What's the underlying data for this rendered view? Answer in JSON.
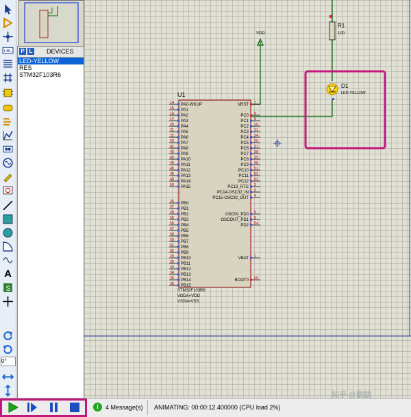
{
  "devices_panel": {
    "p_button": "P",
    "l_button": "L",
    "title": "DEVICES",
    "items": [
      "LED-YELLOW",
      "RES",
      "STM32F103R6"
    ],
    "selected_index": 0
  },
  "toolbar": {
    "rotation_value": "0°"
  },
  "status_bar": {
    "messages": "4 Message(s)",
    "info_icon": "i",
    "animating": "ANIMATING: 00:00:12.400000 (CPU load 2%)",
    "watermark": "知乎 @鼩鼩"
  },
  "schematic": {
    "mcu": {
      "ref": "U1",
      "part": "STM32F103R6",
      "attr_1": "VDDA=VDD",
      "attr_2": "VSSA=VSS",
      "left_pins": [
        {
          "num": "14",
          "name": "PA0-WKUP"
        },
        {
          "num": "15",
          "name": "PA1"
        },
        {
          "num": "16",
          "name": "PA2"
        },
        {
          "num": "17",
          "name": "PA3"
        },
        {
          "num": "20",
          "name": "PA4"
        },
        {
          "num": "21",
          "name": "PA5"
        },
        {
          "num": "22",
          "name": "PA6"
        },
        {
          "num": "23",
          "name": "PA7"
        },
        {
          "num": "41",
          "name": "PA8"
        },
        {
          "num": "42",
          "name": "PA9"
        },
        {
          "num": "43",
          "name": "PA10"
        },
        {
          "num": "44",
          "name": "PA11"
        },
        {
          "num": "45",
          "name": "PA12"
        },
        {
          "num": "46",
          "name": "PA13"
        },
        {
          "num": "49",
          "name": "PA14"
        },
        {
          "num": "50",
          "name": "PA15"
        },
        {
          "num": "26",
          "name": "PB0"
        },
        {
          "num": "27",
          "name": "PB1"
        },
        {
          "num": "28",
          "name": "PB2"
        },
        {
          "num": "55",
          "name": "PB3"
        },
        {
          "num": "56",
          "name": "PB4"
        },
        {
          "num": "57",
          "name": "PB5"
        },
        {
          "num": "58",
          "name": "PB6"
        },
        {
          "num": "59",
          "name": "PB7"
        },
        {
          "num": "61",
          "name": "PB8"
        },
        {
          "num": "62",
          "name": "PB9"
        },
        {
          "num": "29",
          "name": "PB10"
        },
        {
          "num": "30",
          "name": "PB11"
        },
        {
          "num": "33",
          "name": "PB12"
        },
        {
          "num": "34",
          "name": "PB13"
        },
        {
          "num": "35",
          "name": "PB14"
        },
        {
          "num": "36",
          "name": "PB15"
        }
      ],
      "right_pins": [
        {
          "num": "7",
          "name": "NRST"
        },
        {
          "num": "8",
          "name": "PC0"
        },
        {
          "num": "9",
          "name": "PC1"
        },
        {
          "num": "10",
          "name": "PC2"
        },
        {
          "num": "11",
          "name": "PC3"
        },
        {
          "num": "24",
          "name": "PC4"
        },
        {
          "num": "25",
          "name": "PC5"
        },
        {
          "num": "37",
          "name": "PC6"
        },
        {
          "num": "38",
          "name": "PC7"
        },
        {
          "num": "39",
          "name": "PC8"
        },
        {
          "num": "40",
          "name": "PC9"
        },
        {
          "num": "51",
          "name": "PC10"
        },
        {
          "num": "52",
          "name": "PC11"
        },
        {
          "num": "53",
          "name": "PC12"
        },
        {
          "num": "2",
          "name": "PC13_RTC"
        },
        {
          "num": "3",
          "name": "PC14-OSC32_IN"
        },
        {
          "num": "4",
          "name": "PC15-OSC32_OUT"
        },
        {
          "num": "5",
          "name": "OSCIN_PD0"
        },
        {
          "num": "6",
          "name": "OSCOUT_PD1"
        },
        {
          "num": "54",
          "name": "PD2"
        },
        {
          "num": "1",
          "name": "VBAT"
        },
        {
          "num": "60",
          "name": "BOOT0"
        }
      ]
    },
    "vdd_label": "VDD",
    "resistor": {
      "ref": "R1",
      "value": "100"
    },
    "led": {
      "ref": "D1",
      "part": "LED-YELLOW"
    },
    "colors": {
      "wire": "#006600",
      "chip_fill": "#d9d4bf",
      "chip_border": "#8b0000",
      "highlight": "#c2187a",
      "led_lit": "#ffd200",
      "blue_line": "#3040a0"
    }
  }
}
